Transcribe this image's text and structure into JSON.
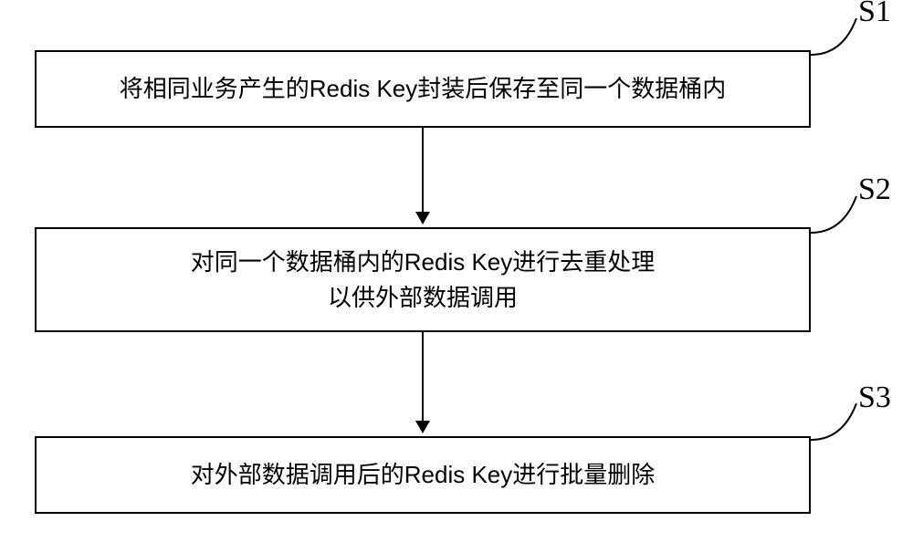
{
  "chart_data": {
    "type": "flowchart",
    "nodes": [
      {
        "id": "S1",
        "label": "S1",
        "text": "将相同业务产生的Redis Key封装后保存至同一个数据桶内"
      },
      {
        "id": "S2",
        "label": "S2",
        "text_line1": "对同一个数据桶内的Redis Key进行去重处理",
        "text_line2": "以供外部数据调用"
      },
      {
        "id": "S3",
        "label": "S3",
        "text": "对外部数据调用后的Redis Key进行批量删除"
      }
    ],
    "edges": [
      {
        "from": "S1",
        "to": "S2"
      },
      {
        "from": "S2",
        "to": "S3"
      }
    ]
  }
}
